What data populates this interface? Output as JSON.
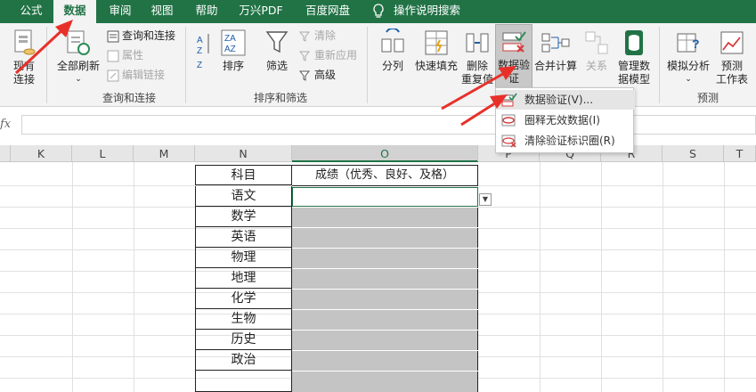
{
  "tabs": [
    "公式",
    "数据",
    "审阅",
    "视图",
    "帮助",
    "万兴PDF",
    "百度网盘",
    "操作说明搜索"
  ],
  "active_tab": "数据",
  "ribbon": {
    "existing_connections": "现有\n连接",
    "existing_line1": "现有",
    "existing_line2": "连接",
    "refresh_all": "全部刷新",
    "queries_connections": "查询和连接",
    "properties": "属性",
    "edit_links": "编辑链接",
    "group_queries": "查询和连接",
    "sort_az": "A↓Z",
    "sort": "排序",
    "filter": "筛选",
    "clear": "清除",
    "reapply": "重新应用",
    "advanced": "高级",
    "group_sort_filter": "排序和筛选",
    "text_to_columns": "分列",
    "flash_fill": "快速填充",
    "remove_dup_line1": "删除",
    "remove_dup_line2": "重复值",
    "data_validation_line1": "数据验",
    "data_validation_line2": "证",
    "consolidate": "合并计算",
    "relationships": "关系",
    "data_model_line1": "管理数",
    "data_model_line2": "据模型",
    "what_if_line1": "模拟分析",
    "forecast_line1": "预测",
    "forecast_line2": "工作表",
    "group_forecast": "预测"
  },
  "formula_bar": {
    "fx": "fx",
    "value": ""
  },
  "columns": [
    "K",
    "L",
    "M",
    "N",
    "O",
    "P",
    "Q",
    "R",
    "S",
    "T"
  ],
  "dropdown_menu": [
    {
      "label": "数据验证(V)...",
      "icon": "data-validation-icon"
    },
    {
      "label": "圈释无效数据(I)",
      "icon": "circle-invalid-icon"
    },
    {
      "label": "清除验证标识圈(R)",
      "icon": "clear-circles-icon"
    }
  ],
  "table": {
    "header_n": "科目",
    "header_o": "成绩（优秀、良好、及格）",
    "subjects": [
      "语文",
      "数学",
      "英语",
      "物理",
      "地理",
      "化学",
      "生物",
      "历史",
      "政治"
    ]
  },
  "colors": {
    "excel_green": "#217346",
    "annotation_red": "#e8302a",
    "cell_gray": "#c4c4c4"
  }
}
